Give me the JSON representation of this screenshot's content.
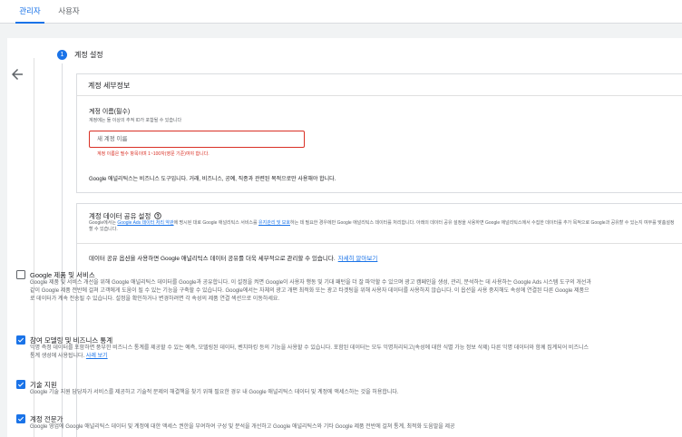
{
  "tabs": [
    {
      "label": "관리자"
    },
    {
      "label": "사용자"
    }
  ],
  "step": {
    "number": "1",
    "title": "계정 설정"
  },
  "account_details": {
    "heading": "계정 세부정보",
    "field_label": "계정 이름(필수)",
    "field_desc": "계정에는 둘 이상의 추적 ID가 포함될 수 있습니다",
    "input_placeholder": "새 계정 이름",
    "input_value": "",
    "error": "계정 이름은 필수 항목이며 1~100자(영문 기준)여야 합니다.",
    "note": "Google 애널리틱스는 비즈니스 도구입니다. 거래, 비즈니스, 공예, 직종과 관련된 목적으로만 사용해야 합니다."
  },
  "data_sharing": {
    "title": "계정 데이터 공유 설정",
    "desc_1": "Google에서는 ",
    "desc_link_1": "Google Ads 데이터 처리 약관",
    "desc_2": "에 명시된 대로 Google 애널리틱스 서비스를 ",
    "desc_link_2": "유지관리 및 보호",
    "desc_3": "하는 데 필요한 경우에만 Google 애널리틱스 데이터를 처리합니다. 아래의 데이터 공유 설정을 사용하면 Google 애널리틱스에서 수집한 데이터를 추가 목적으로 Google과 공유할 수 있는지 여부를 맞춤설정할 수 있습니다.",
    "intro": "데이터 공유 옵션을 사용하면 Google 애널리틱스 데이터 공유를 더욱 세부적으로 관리할 수 있습니다.",
    "intro_link": "자세히 알아보기",
    "options": [
      {
        "title": "Google 제품 및 서비스",
        "checked": false,
        "body": "Google 제품 및 서비스 개선을 위해 Google 애널리틱스 데이터를 Google과 공유합니다. 이 설정을 켜면 Google이 사용자 행동 및 기대 패턴을 더 잘 파악할 수 있으며 광고 캠페인을 생성, 관리, 분석하는 데 사용하는 Google Ads 시스템 도구의 개선과 같이 Google 제품 전반에 걸쳐 고객에게 도움이 될 수 있는 기능을 구축할 수 있습니다. Google에서는 자체의 광고 개편 최적화 또는 광고 타겟팅을 위해 사용자 데이터를 사용하지 않습니다. 이 옵션을 사용 중지해도 속성에 연결된 다른 Google 제품으로 데이터가 계속 전송될 수 있습니다. 설정을 확인하거나 변경하려면 각 속성의 제품 연결 섹션으로 이동하세요."
      },
      {
        "title": "참여 모델링 및 비즈니스 통계",
        "checked": true,
        "body": "익명 측정 데이터를 포함하면 풍부한 비즈니스 통계를 제공할 수 있는 예측, 모델링된 데이터, 벤치마킹 등의 기능을 사용할 수 있습니다. 포함된 데이터는 모두 익명처리되고(속성에 대한 식별 가능 정보 삭제) 다른 익명 데이터와 함께 집계되어 비즈니스 통계 생성에 사용됩니다.",
        "link": "사례 보기"
      },
      {
        "title": "기술 지원",
        "checked": true,
        "body": "Google 기술 지원 담당자가 서비스를 제공하고 기술적 문제의 해결책을 찾기 위해 필요한 경우 내 Google 애널리틱스 데이터 및 계정에 액세스하는 것을 허용합니다."
      },
      {
        "title": "계정 전문가",
        "checked": true,
        "body": "Google 영업에 Google 애널리틱스 데이터 및 계정에 대한 액세스 권한을 부여하여 구성 및 분석을 개선하고 Google 애널리틱스와 기타 Google 제품 전반에 걸쳐 통계, 최적화 도움말을 제공"
      }
    ]
  },
  "colors": {
    "accent": "#1a73e8",
    "error": "#d93025",
    "background": "#f1f3f4"
  },
  "icons": {
    "back": "arrow-back-icon",
    "help": "help-circle-icon",
    "check": "check-icon"
  }
}
